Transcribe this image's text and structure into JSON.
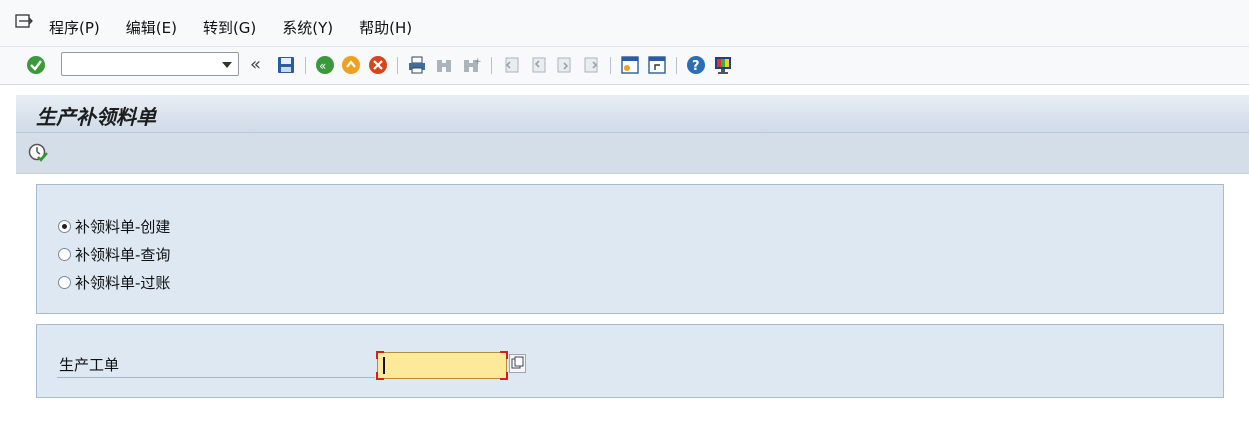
{
  "menubar": {
    "items": [
      "程序(P)",
      "编辑(E)",
      "转到(G)",
      "系统(Y)",
      "帮助(H)"
    ]
  },
  "toolbar": {
    "command_value": "",
    "icons": [
      "enter-icon",
      "back-icon",
      "exit-icon",
      "cancel-icon",
      "print-icon",
      "find-icon",
      "find-next-icon",
      "first-page-icon",
      "prev-page-icon",
      "next-page-icon",
      "last-page-icon",
      "new-session-icon",
      "shortcut-icon",
      "help-icon",
      "layout-icon"
    ]
  },
  "title": "生产补领料单",
  "radios": [
    {
      "label": "补领料单-创建",
      "checked": true
    },
    {
      "label": "补领料单-查询",
      "checked": false
    },
    {
      "label": "补领料单-过账",
      "checked": false
    }
  ],
  "field": {
    "label": "生产工单",
    "value": ""
  },
  "colors": {
    "accent_bg": "#dde8f2",
    "input_bg": "#fde99a"
  }
}
